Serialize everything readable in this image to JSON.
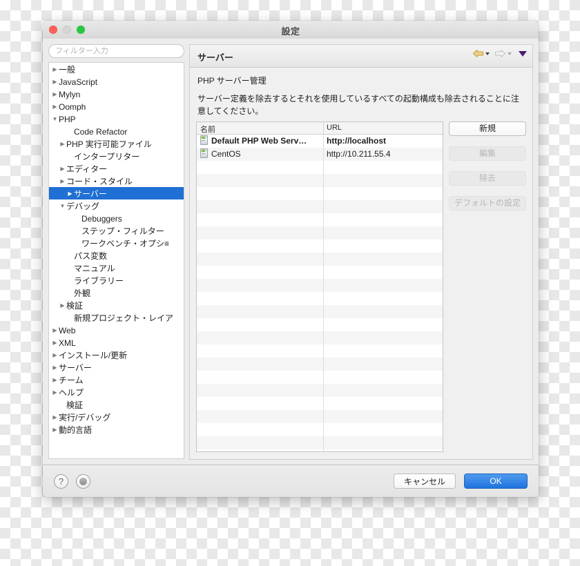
{
  "window": {
    "title": "設定",
    "traffic_lights": [
      "close",
      "minimize",
      "zoom"
    ]
  },
  "sidebar": {
    "filter_placeholder": "フィルター入力",
    "filter_value": "",
    "items": [
      {
        "label": "一般",
        "indent": 0,
        "twisty": "collapsed",
        "selected": false
      },
      {
        "label": "JavaScript",
        "indent": 0,
        "twisty": "collapsed",
        "selected": false
      },
      {
        "label": "Mylyn",
        "indent": 0,
        "twisty": "collapsed",
        "selected": false
      },
      {
        "label": "Oomph",
        "indent": 0,
        "twisty": "collapsed",
        "selected": false
      },
      {
        "label": "PHP",
        "indent": 0,
        "twisty": "expanded",
        "selected": false
      },
      {
        "label": "Code Refactor",
        "indent": 2,
        "twisty": "none",
        "selected": false
      },
      {
        "label": "PHP 実行可能ファイル",
        "indent": 1,
        "twisty": "collapsed",
        "selected": false
      },
      {
        "label": "インタープリター",
        "indent": 2,
        "twisty": "none",
        "selected": false
      },
      {
        "label": "エディター",
        "indent": 1,
        "twisty": "collapsed",
        "selected": false
      },
      {
        "label": "コード・スタイル",
        "indent": 1,
        "twisty": "collapsed",
        "selected": false
      },
      {
        "label": "サーバー",
        "indent": 2,
        "twisty": "none",
        "selected": true
      },
      {
        "label": "デバッグ",
        "indent": 1,
        "twisty": "expanded",
        "selected": false
      },
      {
        "label": "Debuggers",
        "indent": 3,
        "twisty": "none",
        "selected": false
      },
      {
        "label": "ステップ・フィルター",
        "indent": 3,
        "twisty": "none",
        "selected": false
      },
      {
        "label": "ワークベンチ・オプシ≡",
        "indent": 3,
        "twisty": "none",
        "selected": false
      },
      {
        "label": "パス変数",
        "indent": 2,
        "twisty": "none",
        "selected": false
      },
      {
        "label": "マニュアル",
        "indent": 2,
        "twisty": "none",
        "selected": false
      },
      {
        "label": "ライブラリー",
        "indent": 2,
        "twisty": "none",
        "selected": false
      },
      {
        "label": "外観",
        "indent": 2,
        "twisty": "none",
        "selected": false
      },
      {
        "label": "検証",
        "indent": 1,
        "twisty": "collapsed",
        "selected": false
      },
      {
        "label": "新規プロジェクト・レイア",
        "indent": 2,
        "twisty": "none",
        "selected": false
      },
      {
        "label": "Web",
        "indent": 0,
        "twisty": "collapsed",
        "selected": false
      },
      {
        "label": "XML",
        "indent": 0,
        "twisty": "collapsed",
        "selected": false
      },
      {
        "label": "インストール/更新",
        "indent": 0,
        "twisty": "collapsed",
        "selected": false
      },
      {
        "label": "サーバー",
        "indent": 0,
        "twisty": "collapsed",
        "selected": false
      },
      {
        "label": "チーム",
        "indent": 0,
        "twisty": "collapsed",
        "selected": false
      },
      {
        "label": "ヘルプ",
        "indent": 0,
        "twisty": "collapsed",
        "selected": false
      },
      {
        "label": "検証",
        "indent": 1,
        "twisty": "none",
        "selected": false
      },
      {
        "label": "実行/デバッグ",
        "indent": 0,
        "twisty": "collapsed",
        "selected": false
      },
      {
        "label": "動的言語",
        "indent": 0,
        "twisty": "collapsed",
        "selected": false
      }
    ]
  },
  "panel": {
    "title": "サーバー",
    "nav": {
      "back_icon": "back-arrow-icon",
      "back_enabled": true,
      "forward_icon": "forward-arrow-icon",
      "forward_enabled": false,
      "menu_icon": "dropdown-triangle-icon"
    },
    "section_title": "PHP サーバー管理",
    "description": "サーバー定義を除去するとそれを使用しているすべての起動構成も除去されることに注意してください。",
    "table": {
      "columns": [
        "名前",
        "URL"
      ],
      "rows": [
        {
          "name": "Default PHP Web Serv…",
          "url": "http://localhost",
          "icon": "server-icon",
          "bold": true
        },
        {
          "name": "CentOS",
          "url": "http://10.211.55.4",
          "icon": "server-icon",
          "bold": false
        }
      ],
      "empty_row_count": 23
    },
    "buttons": [
      {
        "label": "新規",
        "enabled": true
      },
      {
        "label": "編集",
        "enabled": false
      },
      {
        "label": "除去",
        "enabled": false
      },
      {
        "label": "デフォルトの設定",
        "enabled": false
      }
    ]
  },
  "footer": {
    "help_icon": "question-mark-icon",
    "help_glyph": "?",
    "record_icon": "record-circle-icon",
    "cancel_label": "キャンセル",
    "ok_label": "OK"
  },
  "colors": {
    "selection_blue": "#1f6fd4",
    "ok_button_blue": "#1f74dd",
    "back_arrow_amber": "#e8b84b",
    "forward_arrow_gray": "#d8d8d8",
    "menu_triangle_purple": "#4b1d73",
    "server_icon_green": "#7dc242"
  }
}
